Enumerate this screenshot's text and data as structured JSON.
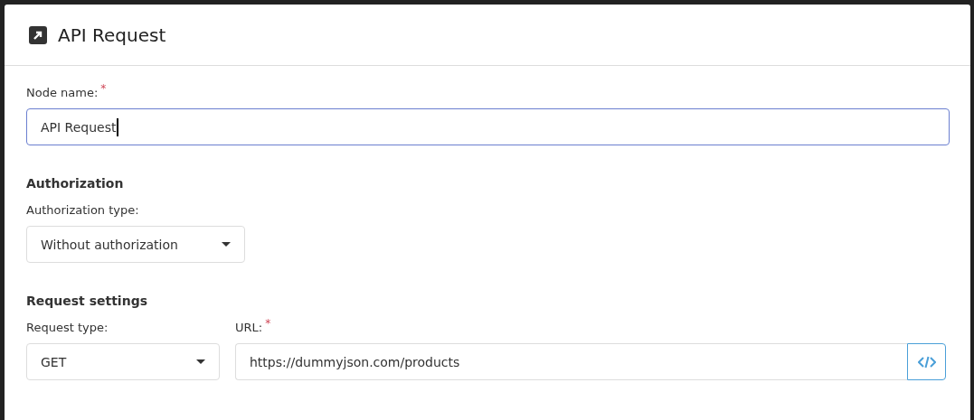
{
  "dialog": {
    "title": "API Request"
  },
  "node_name": {
    "label": "Node name:",
    "required_mark": "*",
    "value": "API Request",
    "focused": true
  },
  "authorization": {
    "heading": "Authorization",
    "type_label": "Authorization type:",
    "type_value": "Without authorization"
  },
  "request_settings": {
    "heading": "Request settings",
    "type_label": "Request type:",
    "type_value": "GET",
    "url_label": "URL:",
    "url_required_mark": "*",
    "url_value": "https://dummyjson.com/products"
  }
}
